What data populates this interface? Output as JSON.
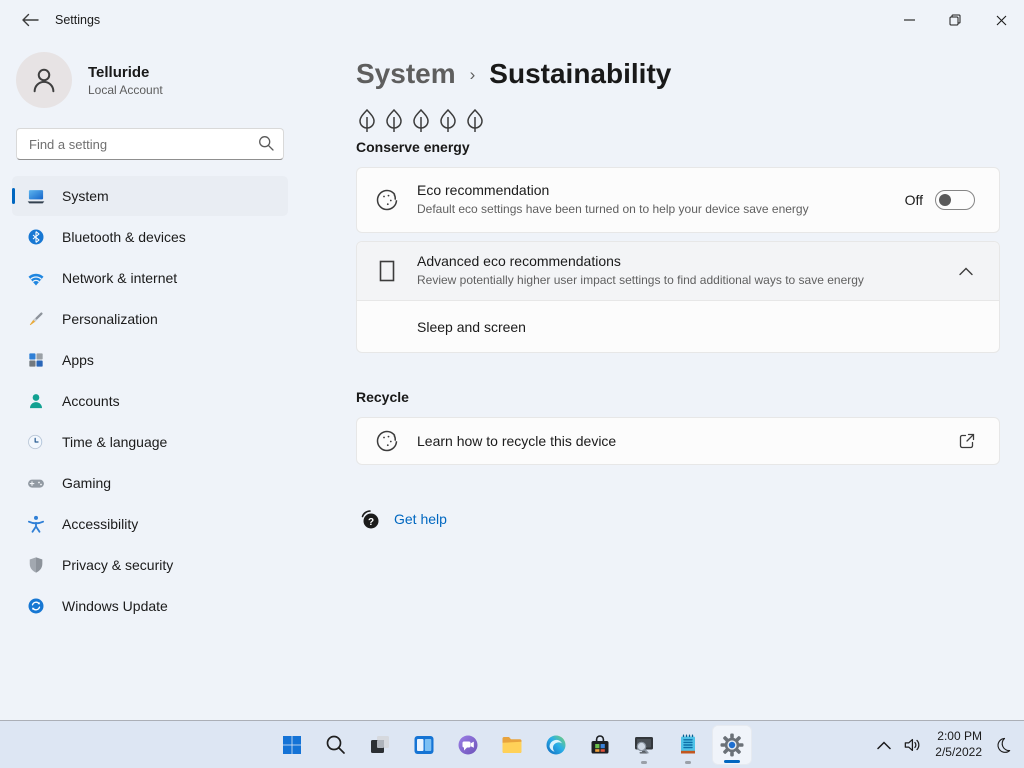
{
  "window": {
    "title": "Settings"
  },
  "user": {
    "name": "Telluride",
    "account_type": "Local Account"
  },
  "search": {
    "placeholder": "Find a setting"
  },
  "sidebar": {
    "items": [
      {
        "label": "System",
        "icon": "system-icon",
        "selected": true
      },
      {
        "label": "Bluetooth & devices",
        "icon": "bluetooth-icon",
        "selected": false
      },
      {
        "label": "Network & internet",
        "icon": "network-icon",
        "selected": false
      },
      {
        "label": "Personalization",
        "icon": "personalization-icon",
        "selected": false
      },
      {
        "label": "Apps",
        "icon": "apps-icon",
        "selected": false
      },
      {
        "label": "Accounts",
        "icon": "accounts-icon",
        "selected": false
      },
      {
        "label": "Time & language",
        "icon": "time-language-icon",
        "selected": false
      },
      {
        "label": "Gaming",
        "icon": "gaming-icon",
        "selected": false
      },
      {
        "label": "Accessibility",
        "icon": "accessibility-icon",
        "selected": false
      },
      {
        "label": "Privacy & security",
        "icon": "privacy-icon",
        "selected": false
      },
      {
        "label": "Windows Update",
        "icon": "windows-update-icon",
        "selected": false
      }
    ]
  },
  "breadcrumb": {
    "parent": "System",
    "separator": "›",
    "current": "Sustainability"
  },
  "content": {
    "conserve": {
      "heading": "Conserve energy",
      "leaf_count": 5
    },
    "eco_card": {
      "title": "Eco recommendation",
      "description": "Default eco settings have been turned on to help your device save energy",
      "toggle_label": "Off",
      "toggle_state": "off"
    },
    "advanced_card": {
      "title": "Advanced eco recommendations",
      "description": "Review potentially higher user impact settings to find additional ways to save energy",
      "expanded": true,
      "rows": [
        {
          "label": "Sleep and screen"
        }
      ]
    },
    "recycle": {
      "heading": "Recycle",
      "link_title": "Learn how to recycle this device"
    },
    "help": {
      "label": "Get help"
    }
  },
  "taskbar": {
    "icons": [
      "start",
      "search",
      "task-view",
      "widgets",
      "chat",
      "file-explorer",
      "edge",
      "store",
      "screen-magnifier",
      "notepad",
      "settings"
    ],
    "active_icon": "settings",
    "running_icons": [
      "screen-magnifier",
      "notepad",
      "settings"
    ],
    "tray": {
      "time": "2:00 PM",
      "date": "2/5/2022"
    }
  },
  "colors": {
    "accent": "#0067c0",
    "window_bg": "#eff3f9",
    "taskbar_bg": "#dde6f3",
    "card_bg": "#fcfcfc",
    "card_border": "#e7e7e7",
    "link": "#0067c0"
  }
}
